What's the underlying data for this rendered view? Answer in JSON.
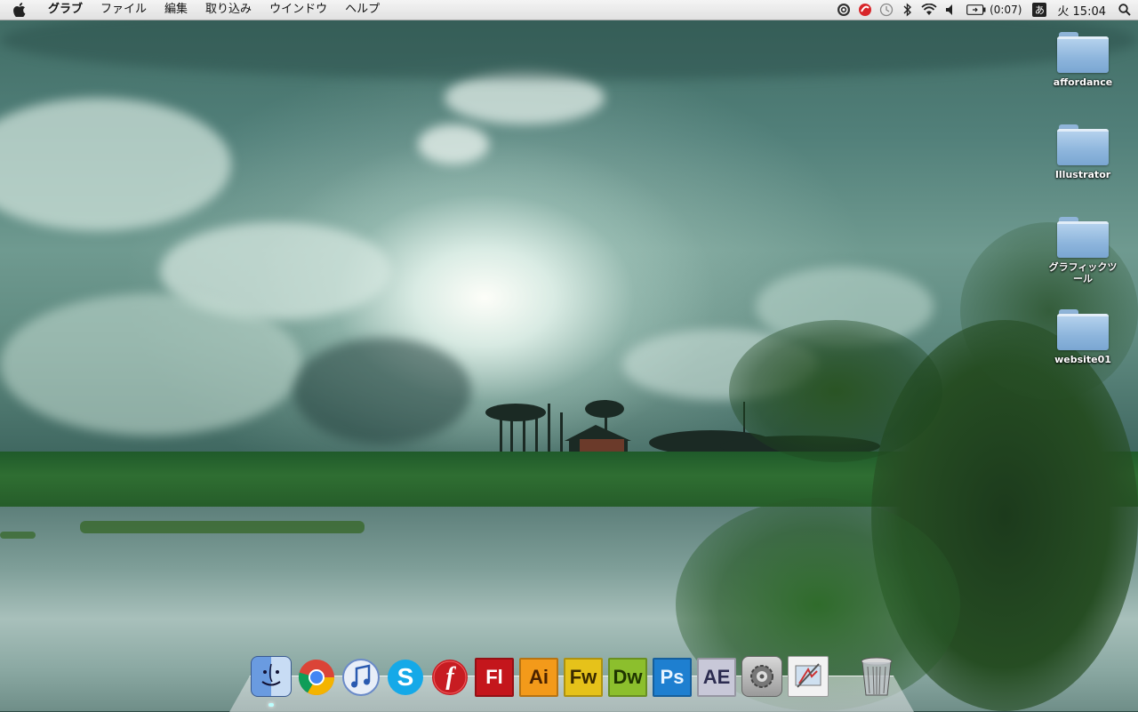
{
  "menubar": {
    "apple_icon": "apple-icon",
    "app_name": "グラブ",
    "items": [
      "ファイル",
      "編集",
      "取り込み",
      "ウインドウ",
      "ヘルプ"
    ],
    "status_icons": [
      "dropbox-icon",
      "red-app-icon",
      "time-machine-icon",
      "bluetooth-icon",
      "wifi-icon",
      "volume-icon"
    ],
    "battery_text": "(0:07)",
    "input_method": "あ",
    "clock": "火 15:04",
    "spotlight_icon": "spotlight-search-icon"
  },
  "desktop": {
    "icons": [
      {
        "label": "affordance"
      },
      {
        "label": "Illustrator"
      },
      {
        "label": "グラフィックツール"
      },
      {
        "label": "website01"
      }
    ]
  },
  "dock": {
    "apps": [
      {
        "name": "finder-icon",
        "text": ""
      },
      {
        "name": "chrome-icon",
        "text": ""
      },
      {
        "name": "itunes-icon",
        "text": ""
      },
      {
        "name": "skype-icon",
        "text": "S"
      },
      {
        "name": "flash-player-icon",
        "text": "f"
      },
      {
        "name": "flash-icon",
        "text": "Fl"
      },
      {
        "name": "illustrator-icon",
        "text": "Ai"
      },
      {
        "name": "fireworks-icon",
        "text": "Fw"
      },
      {
        "name": "dreamweaver-icon",
        "text": "Dw"
      },
      {
        "name": "photoshop-icon",
        "text": "Ps"
      },
      {
        "name": "after-effects-icon",
        "text": "AE"
      },
      {
        "name": "system-preferences-icon",
        "text": ""
      },
      {
        "name": "preview-icon",
        "text": ""
      }
    ],
    "trash": "trash-icon",
    "colors": {
      "flash": "#c4161c",
      "illustrator": "#f39a1a",
      "fireworks": "#e6c21a",
      "dreamweaver": "#8cbf2d",
      "photoshop": "#1e7fd0",
      "after_effects": "#c8c8d8"
    }
  }
}
